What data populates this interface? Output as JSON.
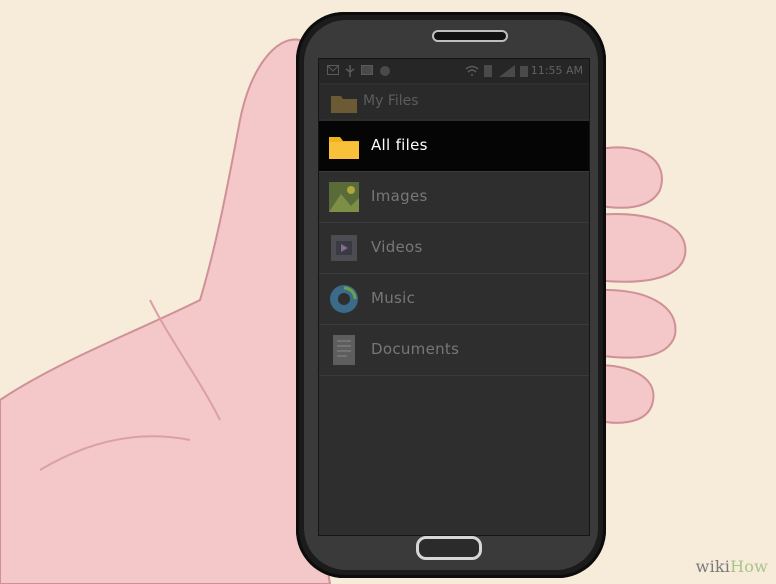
{
  "status_bar": {
    "time": "11:55 AM",
    "icons": [
      "mail-icon",
      "usb-icon",
      "image-icon",
      "chat-icon",
      "wifi-icon",
      "sd-icon",
      "signal-icon",
      "battery-icon"
    ]
  },
  "header": {
    "title": "My Files",
    "icon": "folder-icon"
  },
  "list": {
    "items": [
      {
        "label": "All files",
        "icon": "folder-icon",
        "selected": true
      },
      {
        "label": "Images",
        "icon": "image-icon",
        "selected": false
      },
      {
        "label": "Videos",
        "icon": "video-icon",
        "selected": false
      },
      {
        "label": "Music",
        "icon": "music-icon",
        "selected": false
      },
      {
        "label": "Documents",
        "icon": "document-icon",
        "selected": false
      }
    ]
  },
  "watermark": {
    "wiki": "wiki",
    "how": "How"
  },
  "colors": {
    "selected_bg": "#050505",
    "folder_yellow": "#f2b31a",
    "screen_bg": "#2e2e2e"
  }
}
